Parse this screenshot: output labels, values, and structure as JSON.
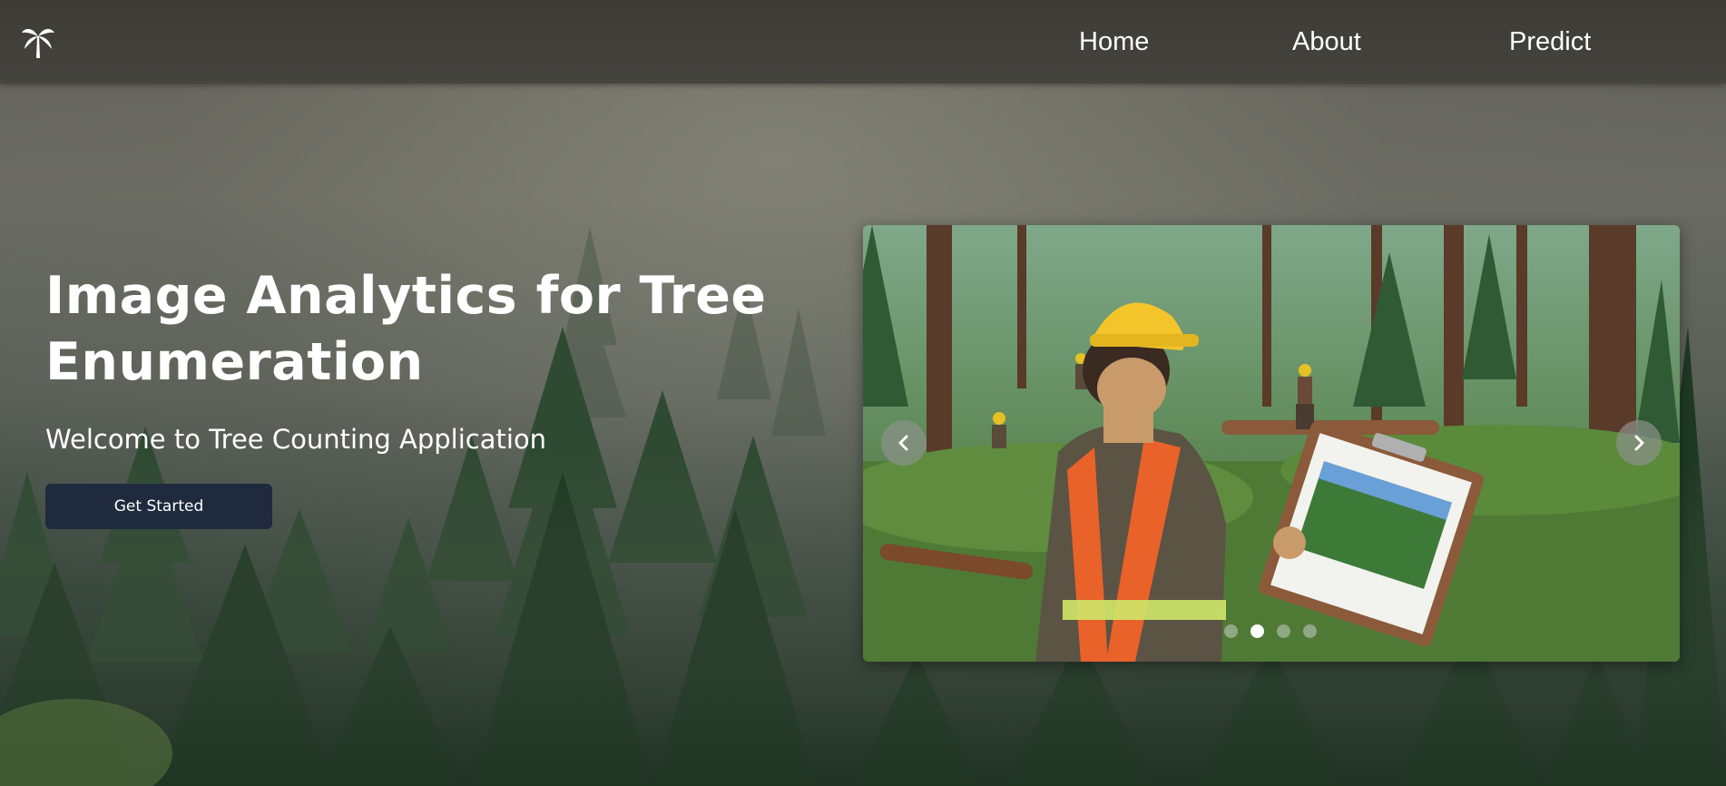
{
  "nav": {
    "logo_icon": "palm-tree-icon",
    "links": [
      {
        "label": "Home"
      },
      {
        "label": "About"
      },
      {
        "label": "Predict"
      }
    ]
  },
  "hero": {
    "title": "Image Analytics for Tree Enumeration",
    "subtitle": "Welcome to Tree Counting Application",
    "cta_label": "Get Started"
  },
  "carousel": {
    "slide_image": "forest-worker-with-clipboard-illustration",
    "prev_icon": "chevron-left-icon",
    "next_icon": "chevron-right-icon",
    "slide_count": 4,
    "active_slide": 2
  },
  "colors": {
    "navbar": "#45443f",
    "button": "#1f2a3e",
    "text": "#ffffff"
  }
}
